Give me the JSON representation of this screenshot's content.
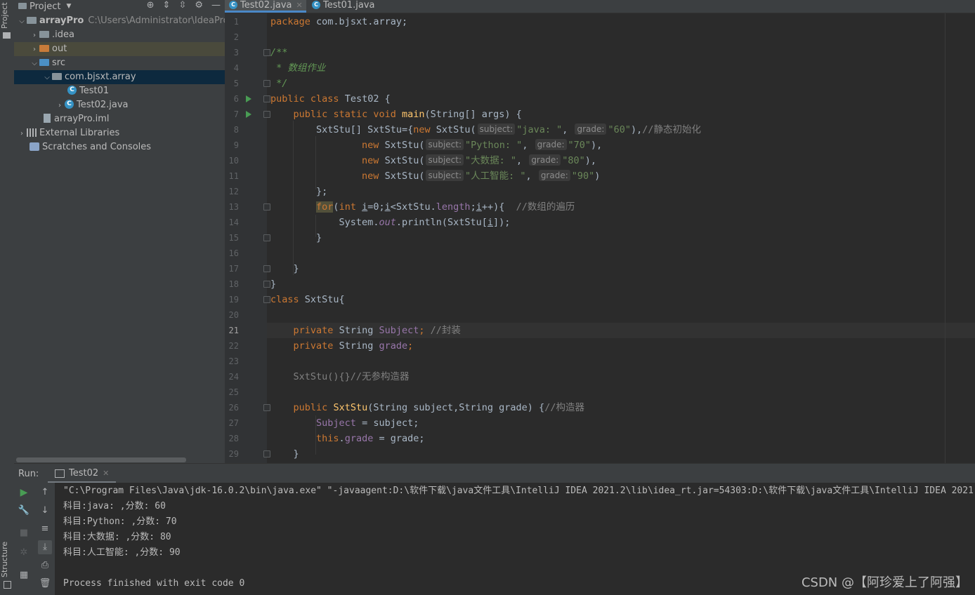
{
  "sidebar_tabs": {
    "project": "Project",
    "structure": "Structure"
  },
  "project_panel": {
    "title": "Project",
    "tree": [
      {
        "label": "arrayPro",
        "path": "C:\\Users\\Administrator\\IdeaProjec"
      },
      {
        "label": ".idea"
      },
      {
        "label": "out"
      },
      {
        "label": "src"
      },
      {
        "label": "com.bjsxt.array"
      },
      {
        "label": "Test01"
      },
      {
        "label": "Test02.java"
      },
      {
        "label": "arrayPro.iml"
      },
      {
        "label": "External Libraries"
      },
      {
        "label": "Scratches and Consoles"
      }
    ]
  },
  "editor_tabs": [
    {
      "label": "Test02.java",
      "active": true
    },
    {
      "label": "Test01.java",
      "active": false
    }
  ],
  "editor": {
    "line_numbers": [
      "1",
      "2",
      "3",
      "4",
      "5",
      "6",
      "7",
      "8",
      "9",
      "10",
      "11",
      "12",
      "13",
      "14",
      "15",
      "16",
      "17",
      "18",
      "19",
      "20",
      "21",
      "22",
      "23",
      "24",
      "25",
      "26",
      "27",
      "28",
      "29"
    ],
    "tokens": {
      "package": "package",
      "package_name": "com.bjsxt.array;",
      "doc_open": "/**",
      "doc_text": " * 数组作业",
      "doc_close": " */",
      "public": "public",
      "class": "class",
      "test02": "Test02 {",
      "static": "static",
      "void": "void",
      "main": "main",
      "main_params": "(String[] args) {",
      "l8_decl": "SxtStu[] SxtStu={",
      "new": "new",
      "ctor": "SxtStu(",
      "hint_subject": "subject:",
      "hint_grade": "grade:",
      "s_java": "\"java: \"",
      "s_60": "\"60\"",
      "c_static_init": "//静态初始化",
      "s_python": "\"Python: \"",
      "s_70": "\"70\"",
      "s_bigdata": "\"大数据: \"",
      "s_80": "\"80\"",
      "s_ai": "\"人工智能: \"",
      "s_90": "\"90\"",
      "comma": ", ",
      "close_comma": "),",
      "close_paren": ")",
      "close_brace_semi": "};",
      "for": "for",
      "for_open": "(",
      "int": "int",
      "var_i": "i",
      "for_mid1": "=0;",
      "for_mid2": "<SxtStu.",
      "length": "length",
      "for_mid3": ";",
      "for_end": "++){  ",
      "c_traverse": "//数组的遍历",
      "sys": "System.",
      "out": "out",
      "println": ".println(SxtStu[",
      "println_end": "]);",
      "rbrace": "}",
      "sxtstu_brace": "SxtStu{",
      "private": "private",
      "string_type": "String",
      "subject_field": "Subject",
      "semi": ";",
      "c_encap": "//封装",
      "grade_field": "grade",
      "noarg_ctor": "SxtStu(){}",
      "c_noarg": "//无参构造器",
      "ctor_name": "SxtStu",
      "ctor_params": "(String subject,String grade) {",
      "c_ctor": "//构造器",
      "assign_subject": " = subject;",
      "this": "this",
      "dot": ".",
      "assign_grade": " = grade;"
    }
  },
  "run_panel": {
    "label": "Run:",
    "tab": "Test02",
    "console": [
      "\"C:\\Program Files\\Java\\jdk-16.0.2\\bin\\java.exe\" \"-javaagent:D:\\软件下载\\java文件工具\\IntelliJ IDEA 2021.2\\lib\\idea_rt.jar=54303:D:\\软件下载\\java文件工具\\IntelliJ IDEA 2021",
      "科目:java: ,分数: 60",
      "科目:Python: ,分数: 70",
      "科目:大数据: ,分数: 80",
      "科目:人工智能: ,分数: 90",
      "",
      "Process finished with exit code 0"
    ]
  },
  "watermark": "CSDN @【阿珍爱上了阿强】",
  "colors": {
    "background": "#2b2b2b",
    "panel": "#3c3f41",
    "keyword": "#cc7832",
    "string": "#6a8759",
    "comment": "#808080",
    "field": "#9876aa",
    "function": "#ffc66d",
    "selection": "#0d293e"
  }
}
